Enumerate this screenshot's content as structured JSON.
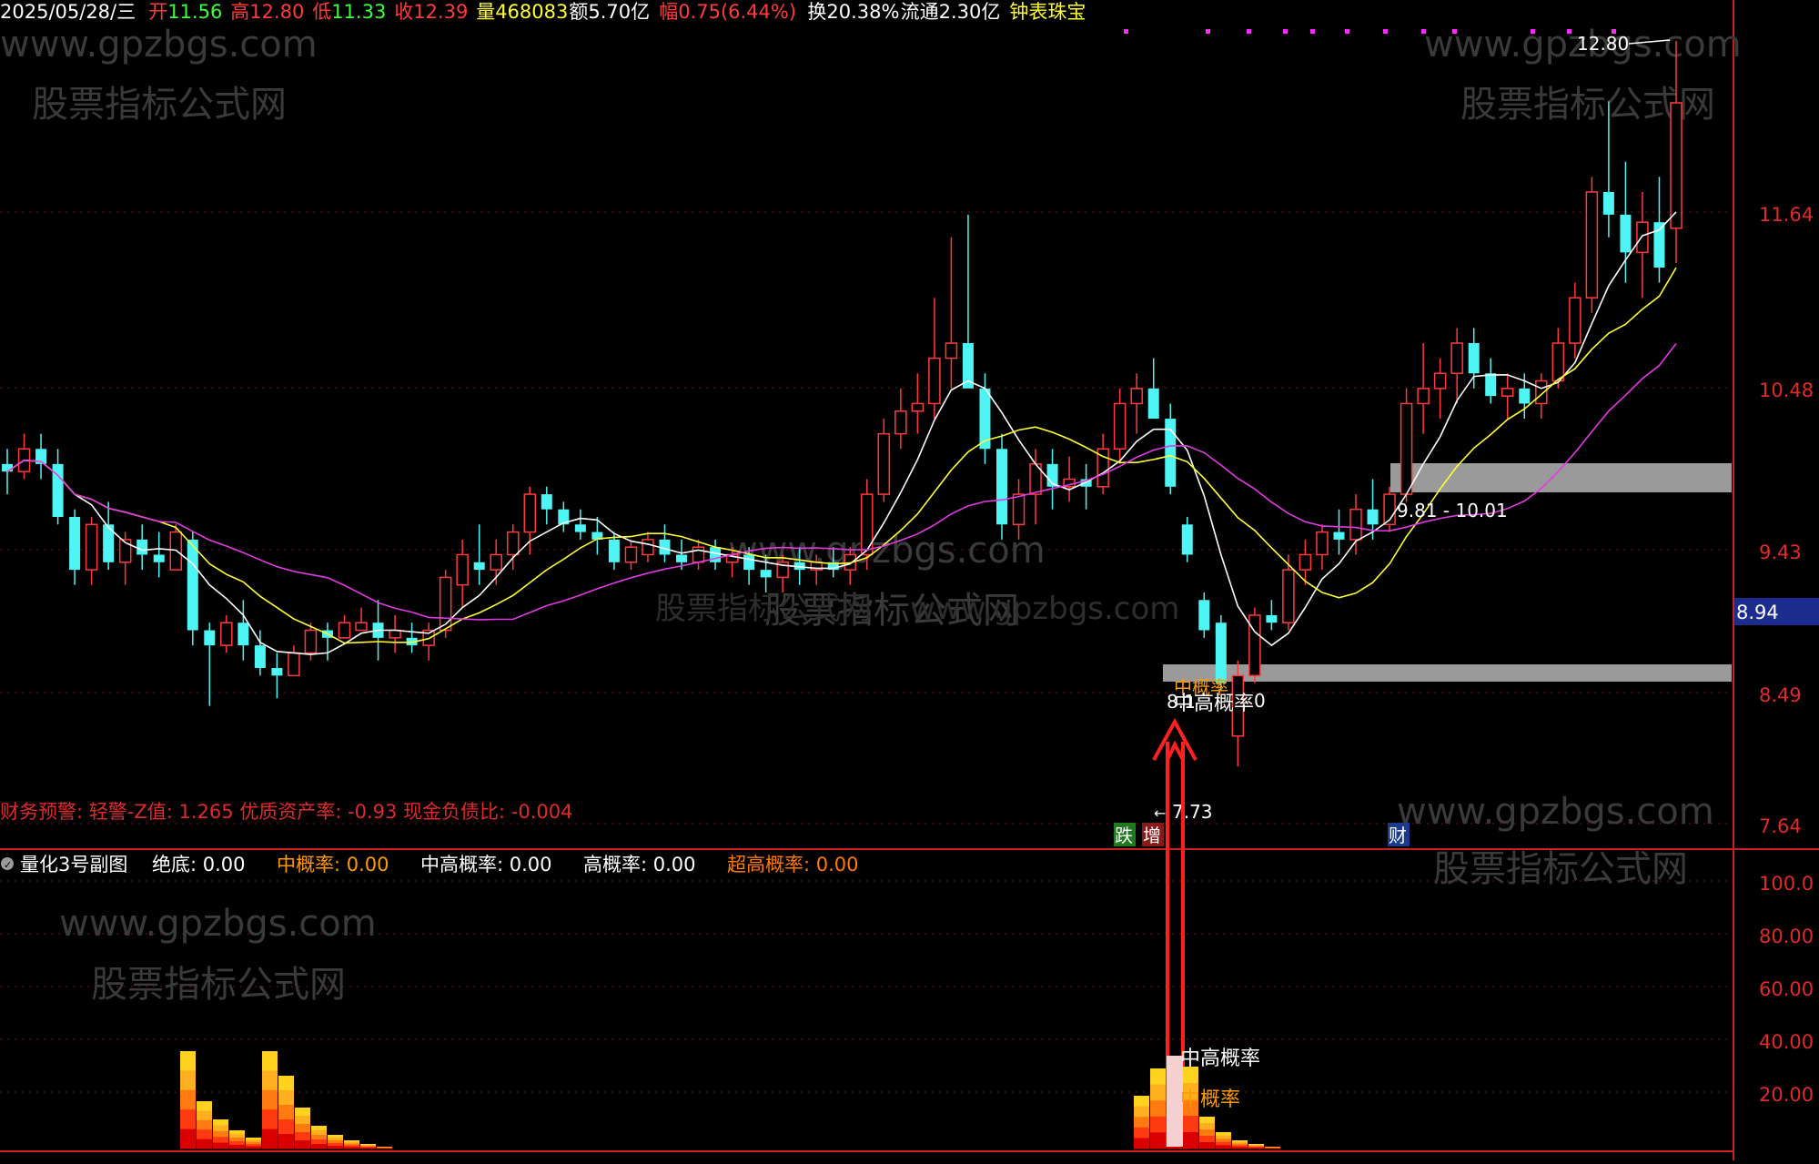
{
  "header": {
    "date": "2025/05/28/三",
    "open_label": "开",
    "open": "11.56",
    "high_label": "高",
    "high": "12.80",
    "low_label": "低",
    "low": "11.33",
    "close_label": "收",
    "close": "12.39",
    "volume_label": "量",
    "volume": "468083",
    "amount_label": "额",
    "amount": "5.70亿",
    "change_label": "幅",
    "change": "0.75(6.44%)",
    "turnover_label": "换",
    "turnover": "20.38%",
    "float_label": "流通",
    "float": "2.30亿",
    "sector": "钟表珠宝"
  },
  "watermarks": {
    "url": "www.gpzbgs.com",
    "name": "股票指标公式网"
  },
  "main_chart": {
    "price_axis": [
      "11.64",
      "10.48",
      "9.43",
      "8.49",
      "7.64"
    ],
    "current_price_tag": "8.94",
    "high_marker": "12.80",
    "low_marker": "7.73",
    "zone_upper_label": "9.81 - 10.01",
    "zone_lower_label_1": "中概率",
    "zone_lower_label_2": "中高概率",
    "zone_lower_label_3": "8.1",
    "zone_lower_label_4": "0",
    "finance_warning": "财务预警: 轻警-Z值: 1.265 优质资产率: -0.93 现金负债比: -0.004",
    "badges": [
      "跌",
      "增",
      "财"
    ],
    "colors": {
      "up": "#ff3a3a",
      "down": "#4ff5f5",
      "ma5": "#ffffff",
      "ma10": "#ffff33",
      "ma20": "#e23ae2",
      "zone": "#9a9a9a"
    }
  },
  "sub_chart": {
    "title": "量化3号副图",
    "series": [
      {
        "label": "绝底:",
        "value": "0.00",
        "color": "#ffffff"
      },
      {
        "label": "中概率:",
        "value": "0.00",
        "color": "#ff9a00"
      },
      {
        "label": "中高概率:",
        "value": "0.00",
        "color": "#ffffff"
      },
      {
        "label": "高概率:",
        "value": "0.00",
        "color": "#ffffff"
      },
      {
        "label": "超高概率:",
        "value": "0.00",
        "color": "#ff7a00"
      }
    ],
    "axis": [
      "100.0",
      "80.00",
      "60.00",
      "40.00",
      "20.00"
    ],
    "marker_mid_high": "中高概率",
    "marker_mid": "中概率"
  },
  "chart_data": {
    "type": "candlestick",
    "title": "",
    "ylim": [
      7.5,
      12.95
    ],
    "candles": [
      [
        10.0,
        10.1,
        9.8,
        9.95
      ],
      [
        9.95,
        10.2,
        9.9,
        10.1
      ],
      [
        10.1,
        10.2,
        9.9,
        10.0
      ],
      [
        10.0,
        10.1,
        9.6,
        9.65
      ],
      [
        9.65,
        9.7,
        9.2,
        9.3
      ],
      [
        9.3,
        9.65,
        9.2,
        9.6
      ],
      [
        9.6,
        9.75,
        9.3,
        9.35
      ],
      [
        9.35,
        9.55,
        9.2,
        9.5
      ],
      [
        9.5,
        9.6,
        9.3,
        9.4
      ],
      [
        9.4,
        9.55,
        9.25,
        9.35
      ],
      [
        9.3,
        9.6,
        9.3,
        9.55
      ],
      [
        9.5,
        9.55,
        8.8,
        8.9
      ],
      [
        8.9,
        8.95,
        8.4,
        8.8
      ],
      [
        8.8,
        9.0,
        8.75,
        8.95
      ],
      [
        8.95,
        9.1,
        8.7,
        8.8
      ],
      [
        8.8,
        8.9,
        8.6,
        8.65
      ],
      [
        8.65,
        8.75,
        8.45,
        8.6
      ],
      [
        8.6,
        8.8,
        8.6,
        8.75
      ],
      [
        8.75,
        8.95,
        8.7,
        8.9
      ],
      [
        8.9,
        8.95,
        8.7,
        8.85
      ],
      [
        8.85,
        9.0,
        8.85,
        8.95
      ],
      [
        8.9,
        9.05,
        8.95,
        8.95
      ],
      [
        8.95,
        9.1,
        8.7,
        8.85
      ],
      [
        8.85,
        9.0,
        8.75,
        8.9
      ],
      [
        8.85,
        8.95,
        8.75,
        8.8
      ],
      [
        8.8,
        8.95,
        8.7,
        8.9
      ],
      [
        8.9,
        9.3,
        8.85,
        9.25
      ],
      [
        9.2,
        9.5,
        9.05,
        9.4
      ],
      [
        9.35,
        9.6,
        9.2,
        9.3
      ],
      [
        9.3,
        9.5,
        9.2,
        9.4
      ],
      [
        9.4,
        9.6,
        9.3,
        9.55
      ],
      [
        9.55,
        9.85,
        9.4,
        9.8
      ],
      [
        9.8,
        9.85,
        9.6,
        9.7
      ],
      [
        9.7,
        9.75,
        9.55,
        9.6
      ],
      [
        9.6,
        9.7,
        9.5,
        9.55
      ],
      [
        9.55,
        9.65,
        9.4,
        9.5
      ],
      [
        9.5,
        9.55,
        9.3,
        9.35
      ],
      [
        9.35,
        9.5,
        9.3,
        9.45
      ],
      [
        9.4,
        9.55,
        9.35,
        9.5
      ],
      [
        9.5,
        9.6,
        9.35,
        9.4
      ],
      [
        9.4,
        9.5,
        9.3,
        9.35
      ],
      [
        9.35,
        9.5,
        9.3,
        9.45
      ],
      [
        9.45,
        9.5,
        9.3,
        9.35
      ],
      [
        9.35,
        9.45,
        9.25,
        9.4
      ],
      [
        9.4,
        9.45,
        9.2,
        9.3
      ],
      [
        9.3,
        9.4,
        9.15,
        9.25
      ],
      [
        9.25,
        9.4,
        9.15,
        9.35
      ],
      [
        9.35,
        9.45,
        9.2,
        9.3
      ],
      [
        9.3,
        9.4,
        9.2,
        9.35
      ],
      [
        9.35,
        9.45,
        9.25,
        9.3
      ],
      [
        9.3,
        9.45,
        9.2,
        9.4
      ],
      [
        9.4,
        9.9,
        9.3,
        9.8
      ],
      [
        9.8,
        10.3,
        9.75,
        10.2
      ],
      [
        10.2,
        10.5,
        10.1,
        10.35
      ],
      [
        10.35,
        10.6,
        10.2,
        10.4
      ],
      [
        10.4,
        11.1,
        10.3,
        10.7
      ],
      [
        10.7,
        11.5,
        10.5,
        10.8
      ],
      [
        10.8,
        11.65,
        10.6,
        10.5
      ],
      [
        10.5,
        10.6,
        10.0,
        10.1
      ],
      [
        10.1,
        10.2,
        9.5,
        9.6
      ],
      [
        9.6,
        9.9,
        9.5,
        9.8
      ],
      [
        9.8,
        10.1,
        9.6,
        10.0
      ],
      [
        10.0,
        10.1,
        9.7,
        9.85
      ],
      [
        9.85,
        10.05,
        9.75,
        9.9
      ],
      [
        9.9,
        10.0,
        9.7,
        9.85
      ],
      [
        9.85,
        10.2,
        9.8,
        10.1
      ],
      [
        10.1,
        10.5,
        10.0,
        10.4
      ],
      [
        10.4,
        10.6,
        10.2,
        10.5
      ],
      [
        10.5,
        10.7,
        10.3,
        10.3
      ],
      [
        10.3,
        10.4,
        9.8,
        9.85
      ],
      [
        9.6,
        9.65,
        9.35,
        9.4
      ],
      [
        9.1,
        9.15,
        8.85,
        8.9
      ],
      [
        8.95,
        9.0,
        8.5,
        8.55
      ],
      [
        8.2,
        8.7,
        8.0,
        8.6
      ],
      [
        8.6,
        9.05,
        8.55,
        9.0
      ],
      [
        9.0,
        9.1,
        8.9,
        8.95
      ],
      [
        8.95,
        9.4,
        8.9,
        9.3
      ],
      [
        9.3,
        9.5,
        9.2,
        9.4
      ],
      [
        9.4,
        9.6,
        9.3,
        9.55
      ],
      [
        9.55,
        9.7,
        9.4,
        9.5
      ],
      [
        9.5,
        9.8,
        9.4,
        9.7
      ],
      [
        9.7,
        9.9,
        9.5,
        9.6
      ],
      [
        9.6,
        9.85,
        9.55,
        9.8
      ],
      [
        9.8,
        10.5,
        9.75,
        10.4
      ],
      [
        10.4,
        10.8,
        10.2,
        10.5
      ],
      [
        10.5,
        10.7,
        10.3,
        10.6
      ],
      [
        10.6,
        10.9,
        10.4,
        10.8
      ],
      [
        10.8,
        10.9,
        10.5,
        10.6
      ],
      [
        10.6,
        10.7,
        10.4,
        10.45
      ],
      [
        10.45,
        10.6,
        10.3,
        10.5
      ],
      [
        10.5,
        10.6,
        10.3,
        10.4
      ],
      [
        10.4,
        10.6,
        10.3,
        10.55
      ],
      [
        10.55,
        10.9,
        10.5,
        10.8
      ],
      [
        10.8,
        11.2,
        10.7,
        11.1
      ],
      [
        11.1,
        11.9,
        11.0,
        11.8
      ],
      [
        11.8,
        12.4,
        11.5,
        11.65
      ],
      [
        11.65,
        12.0,
        11.2,
        11.4
      ],
      [
        11.4,
        11.8,
        11.1,
        11.6
      ],
      [
        11.6,
        11.9,
        11.2,
        11.3
      ],
      [
        11.56,
        12.8,
        11.33,
        12.39
      ]
    ]
  }
}
